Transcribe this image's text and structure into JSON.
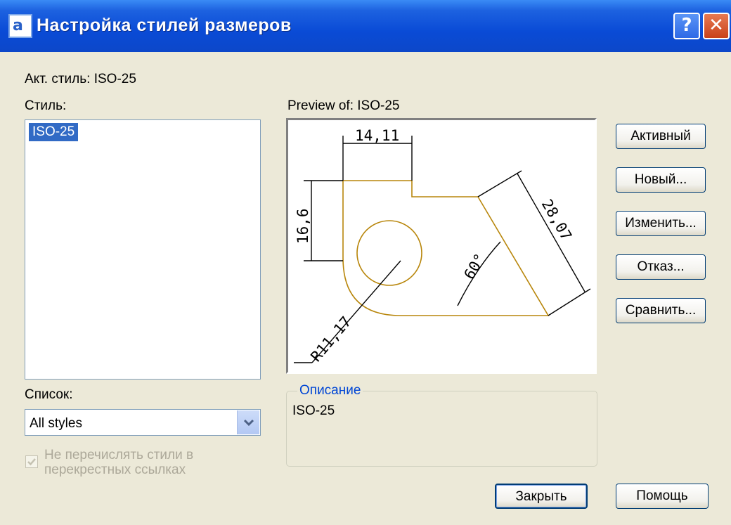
{
  "window": {
    "title": "Настройка стилей размеров",
    "icon": "dimstyle-app-icon",
    "help_glyph": "?",
    "close_glyph": "✕"
  },
  "current_style": "Акт. стиль: ISO-25",
  "styles": {
    "label": "Стиль:",
    "items": [
      "ISO-25"
    ],
    "selected": "ISO-25"
  },
  "preview": {
    "label": "Preview of: ISO-25",
    "dims": {
      "top": "14,11",
      "left": "16,6",
      "diag": "28,07",
      "angle": "60°",
      "radius": "R11,17"
    },
    "colors": {
      "geometry": "#b8860b",
      "dimension": "#000000"
    }
  },
  "buttons": {
    "set_current": "Активный",
    "new": "Новый...",
    "modify": "Изменить...",
    "override": "Отказ...",
    "compare": "Сравнить..."
  },
  "list": {
    "label": "Список:",
    "value": "All styles"
  },
  "checkbox": {
    "label": "Не перечислять стили в перекрестных ссылках",
    "checked": true,
    "enabled": false
  },
  "description": {
    "legend": "Описание",
    "text": "ISO-25"
  },
  "footer": {
    "close": "Закрыть",
    "help": "Помощь"
  }
}
